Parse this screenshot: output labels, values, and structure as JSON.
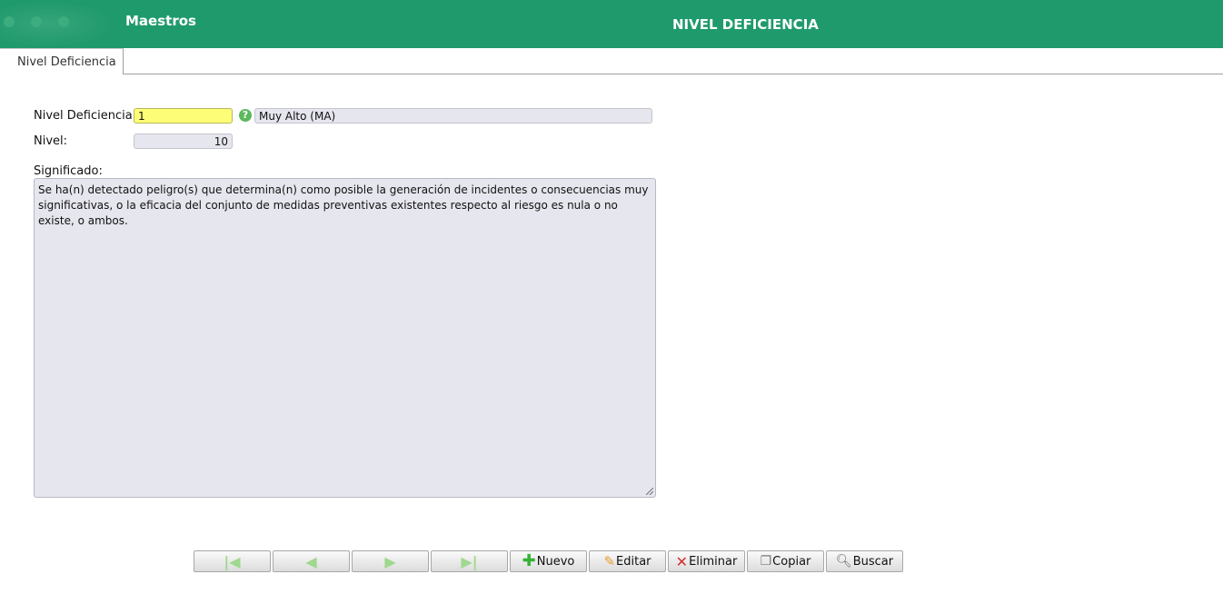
{
  "header": {
    "app_title": "Maestros",
    "page_title": "NIVEL DEFICIENCIA"
  },
  "tabs": [
    {
      "label": "Nivel Deficiencia"
    }
  ],
  "form": {
    "nivel_deficiencia": {
      "label": "Nivel Deficiencia:",
      "value": "1",
      "description": "Muy Alto (MA)"
    },
    "nivel": {
      "label": "Nivel:",
      "value": "10"
    },
    "significado": {
      "label": "Significado:",
      "value": "Se ha(n) detectado peligro(s) que determina(n) como posible la generación de incidentes o consecuencias muy significativas, o la eficacia del conjunto de medidas preventivas existentes respecto al riesgo es nula o no existe, o ambos."
    }
  },
  "toolbar": {
    "nuevo": "Nuevo",
    "editar": "Editar",
    "eliminar": "Eliminar",
    "copiar": "Copiar",
    "buscar": "Buscar"
  },
  "colors": {
    "header": "#1f9a6c",
    "highlight_field": "#fdfd77",
    "readonly_field": "#e6e6ee"
  }
}
